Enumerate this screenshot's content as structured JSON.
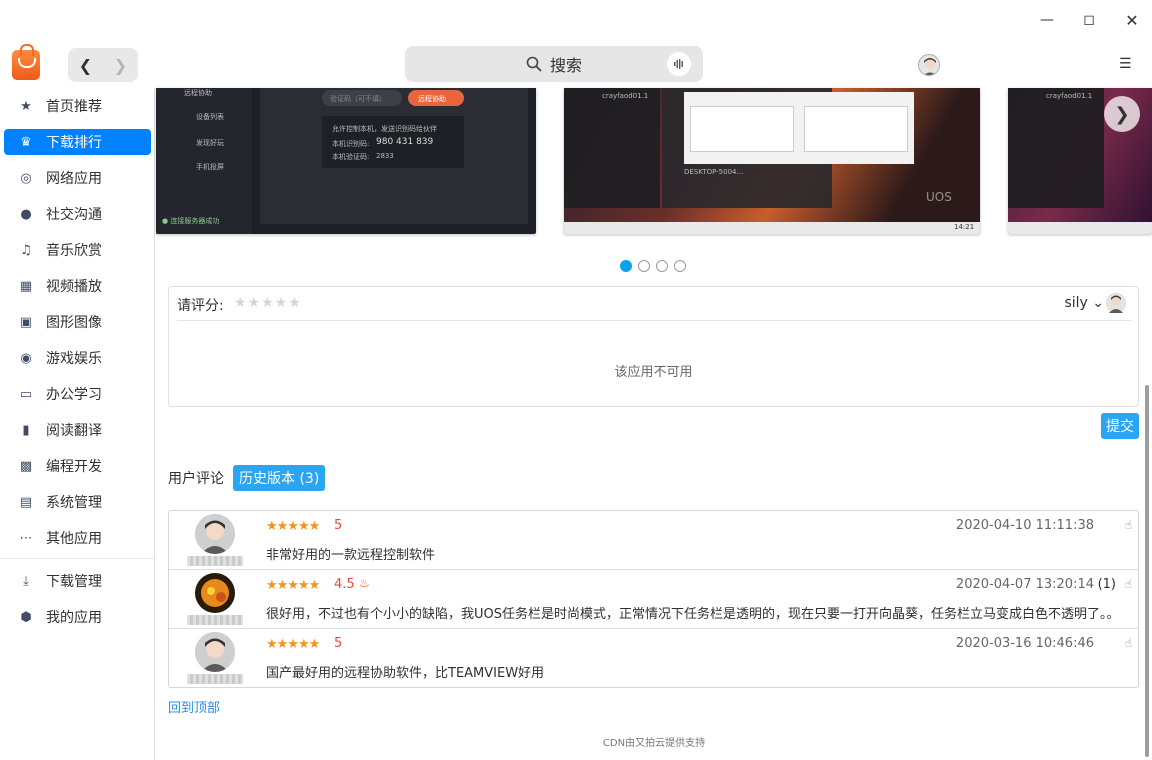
{
  "window": {
    "minimize_icon": "minimize-icon",
    "maximize_icon": "maximize-icon",
    "close_icon": "close-icon"
  },
  "header": {
    "search_placeholder": "搜索",
    "menu_icon": "hamburger-icon"
  },
  "sidebar": {
    "items": [
      {
        "label": "首页推荐",
        "icon": "star-icon"
      },
      {
        "label": "下载排行",
        "icon": "crown-icon",
        "active": true
      },
      {
        "label": "网络应用",
        "icon": "globe-icon"
      },
      {
        "label": "社交沟通",
        "icon": "chat-icon"
      },
      {
        "label": "音乐欣赏",
        "icon": "music-icon"
      },
      {
        "label": "视频播放",
        "icon": "film-icon"
      },
      {
        "label": "图形图像",
        "icon": "image-icon"
      },
      {
        "label": "游戏娱乐",
        "icon": "gamepad-icon"
      },
      {
        "label": "办公学习",
        "icon": "office-icon"
      },
      {
        "label": "阅读翻译",
        "icon": "book-icon"
      },
      {
        "label": "编程开发",
        "icon": "terminal-icon"
      },
      {
        "label": "系统管理",
        "icon": "system-icon"
      },
      {
        "label": "其他应用",
        "icon": "more-icon"
      }
    ],
    "bottom_items": [
      {
        "label": "下载管理",
        "icon": "download-icon"
      },
      {
        "label": "我的应用",
        "icon": "box-icon"
      }
    ]
  },
  "screenshots": {
    "shot1": {
      "menu": [
        "远程协助",
        "设备列表",
        "发现好玩",
        "手机投屏"
      ],
      "code_placeholder": "验证码（可不填）",
      "connect_button": "远程协助",
      "tip": "允许控制本机，发送识别码给伙伴",
      "id_label": "本机识别码:",
      "id_value": "980 431 839",
      "code_label": "本机验证码:",
      "code_value": "2833",
      "status": "连接服务器成功"
    },
    "shot2": {
      "host": "crayfaod01.1",
      "clock": "14:21",
      "brand": "UOS",
      "device": "DESKTOP-5004..."
    },
    "shot3": {
      "host": "crayfaod01.1"
    }
  },
  "carousel": {
    "active_index": 0,
    "dots": 4
  },
  "rating": {
    "label": "请评分:",
    "stars": "★★★★★",
    "user": "sily",
    "message": "该应用不可用",
    "submit": "提交"
  },
  "tabs": [
    {
      "label": "用户评论"
    },
    {
      "label": "历史版本 (3)",
      "active": true
    }
  ],
  "comments": [
    {
      "stars": "★★★★★",
      "score": "5",
      "date": "2020-04-10 11:11:38",
      "text": "非常好用的一款远程控制软件",
      "likes": ""
    },
    {
      "stars": "★★★★★",
      "score": "4.5",
      "hot": "♨",
      "date": "2020-04-07 13:20:14",
      "text": "很好用，不过也有个小小的缺陷，我UOS任务栏是时尚模式，正常情况下任务栏是透明的，现在只要一打开向晶葵，任务栏立马变成白色不透明了。。",
      "likes": "(1)"
    },
    {
      "stars": "★★★★★",
      "score": "5",
      "date": "2020-03-16 10:46:46",
      "text": "国产最好用的远程协助软件，比TEAMVIEW好用",
      "likes": ""
    }
  ],
  "footer": {
    "back_to_top": "回到顶部",
    "cdn": "CDN由又拍云提供支持"
  }
}
